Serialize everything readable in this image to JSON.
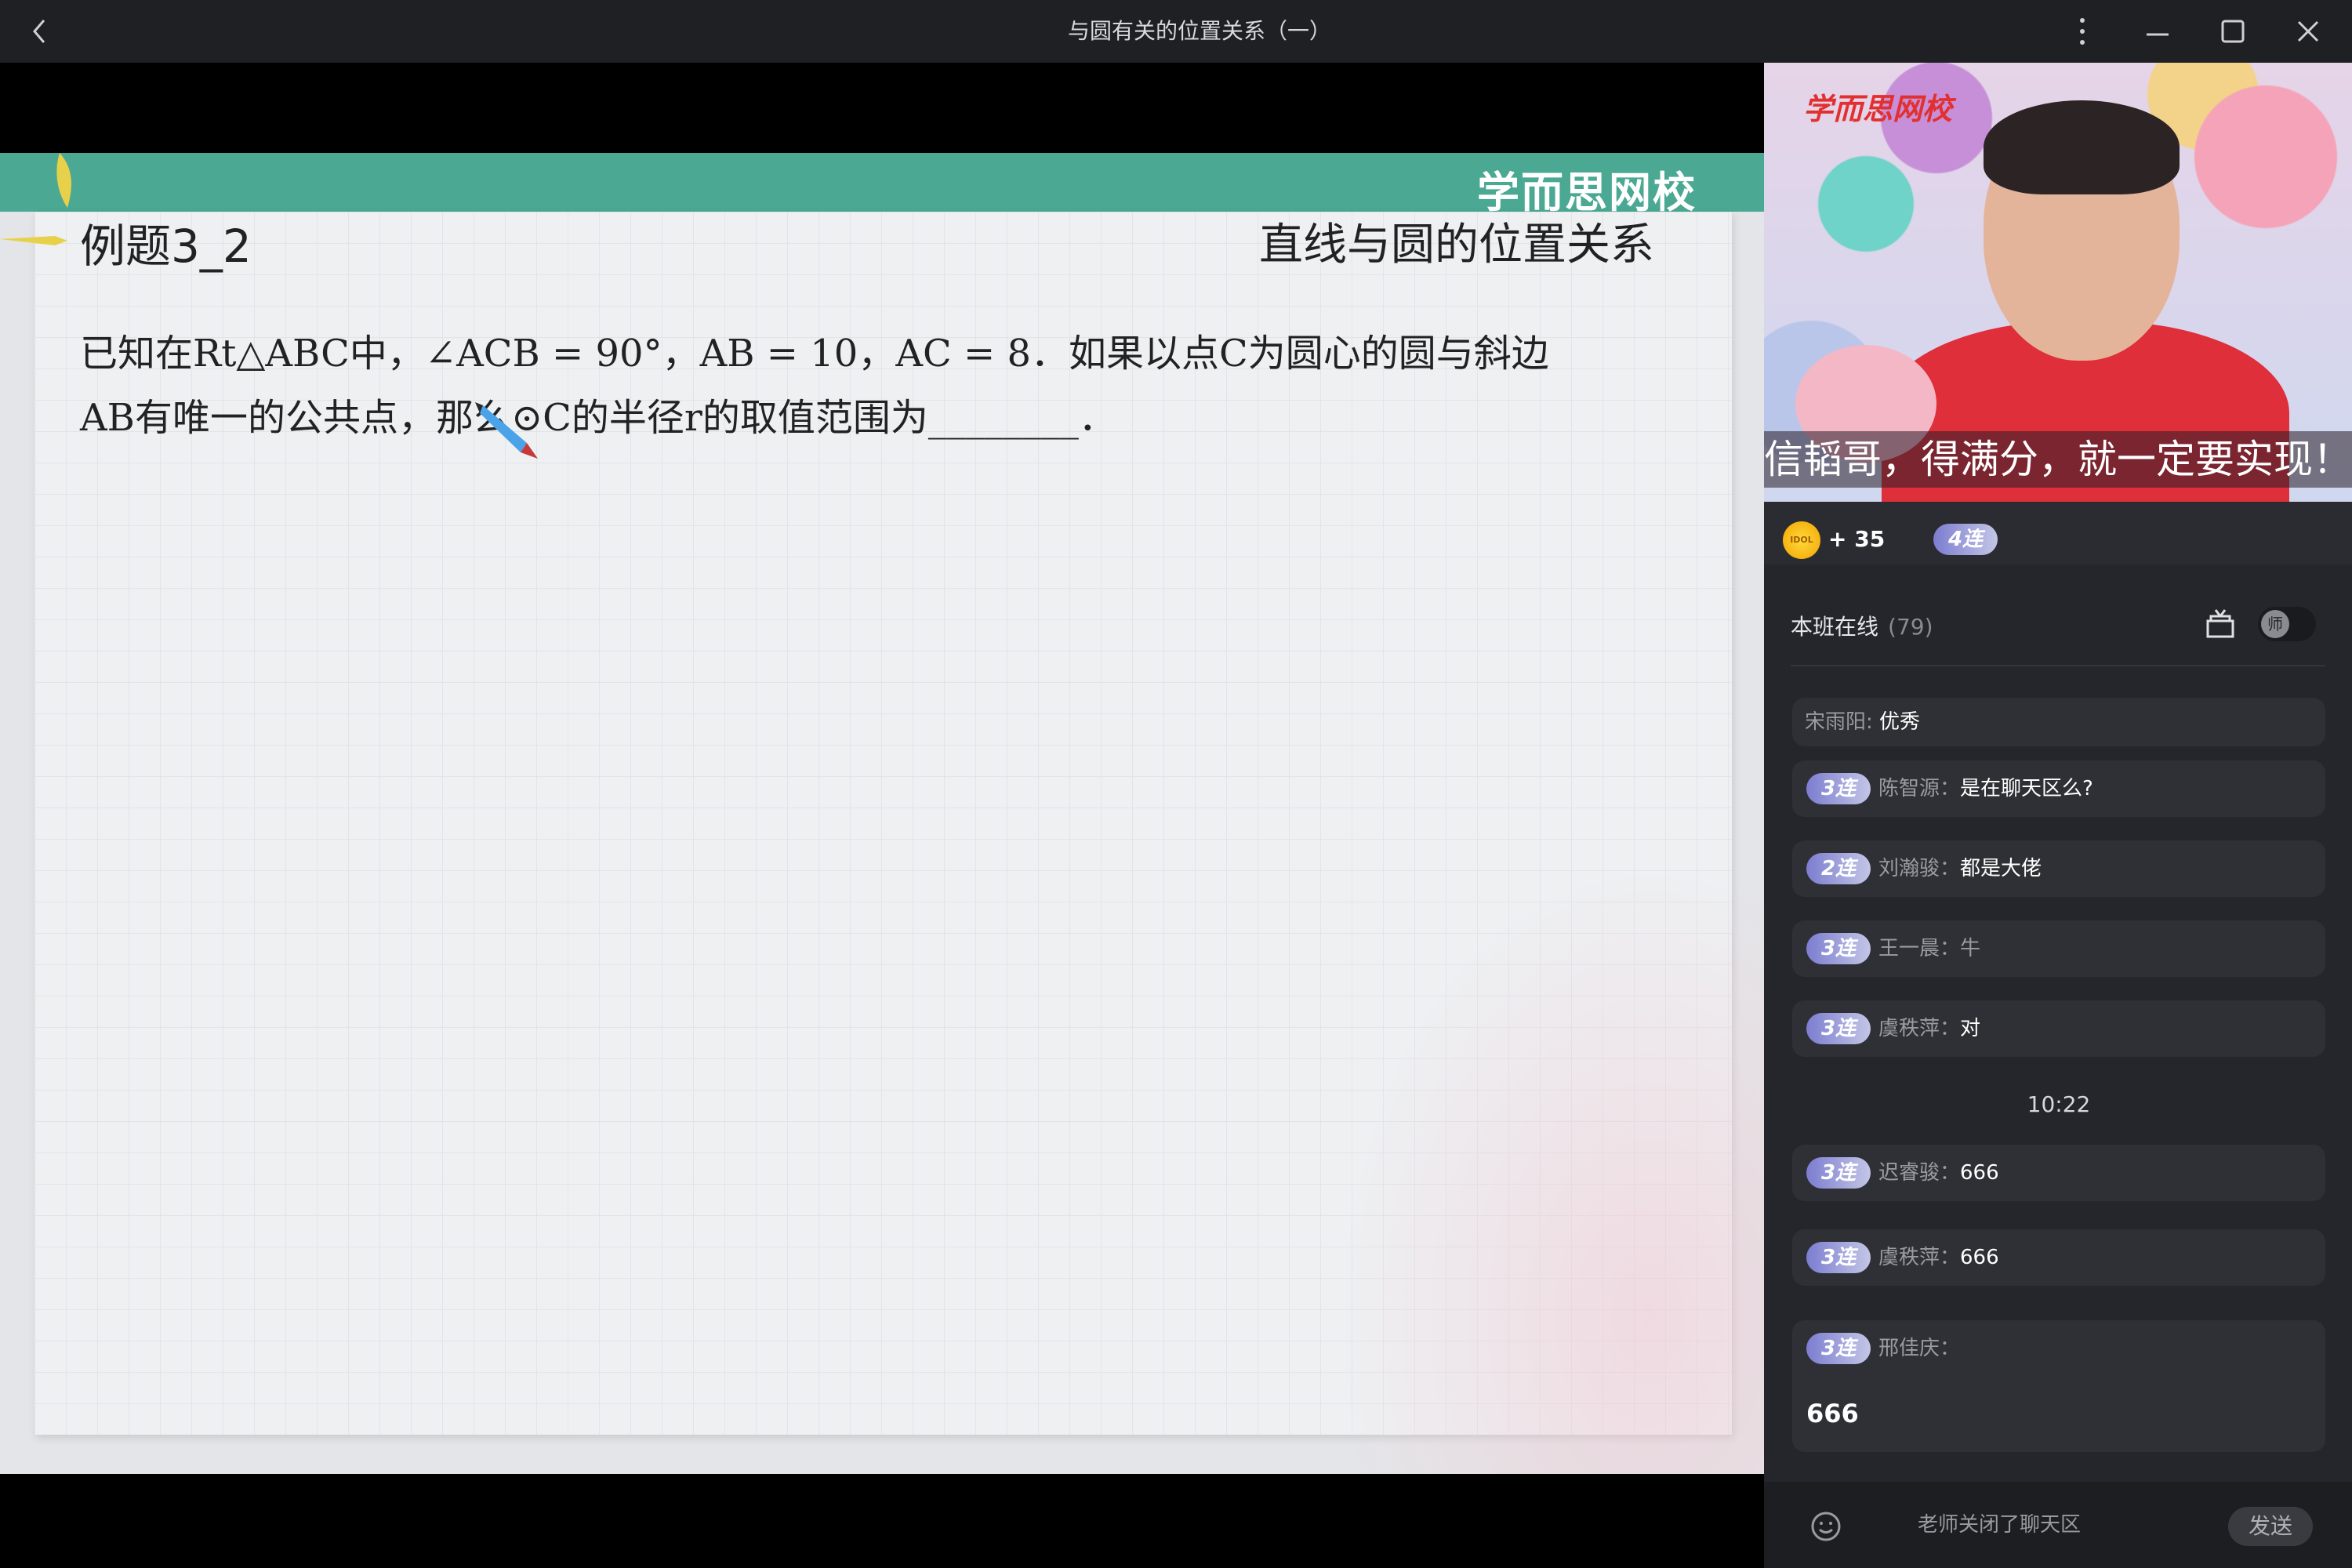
{
  "window": {
    "title": "与圆有关的位置关系（一）"
  },
  "slide": {
    "brand": "学而思网校",
    "example_title": "例题3_2",
    "topic": "直线与圆的位置关系",
    "problem_line1": "已知在Rt△ABC中，∠ACB = 90°，AB = 10，AC = 8．如果以点C为圆心的圆与斜边",
    "problem_line2": "AB有唯一的公共点，那么⊙C的半径r的取值范围为________．"
  },
  "video": {
    "logo": "学而思网校",
    "slogan": "信韬哥，得满分，就一定要实现！"
  },
  "rewards": {
    "coin_label": "IDOL",
    "coin_count": "+ 35",
    "streak": "4连"
  },
  "online": {
    "label": "本班在线",
    "count": "(79)",
    "teacher_toggle": "师"
  },
  "chat": {
    "messages": [
      {
        "streak": "",
        "name": "宋雨阳:",
        "text": "优秀"
      },
      {
        "streak": "3连",
        "name": "陈智源：",
        "text": "是在聊天区么?"
      },
      {
        "streak": "2连",
        "name": "刘瀚骏：",
        "text": "都是大佬"
      },
      {
        "streak": "3连",
        "name": "王一晨：",
        "text": "牛"
      },
      {
        "streak": "3连",
        "name": "虞秩萍：",
        "text": "对"
      },
      {
        "streak": "3连",
        "name": "迟睿骏：",
        "text": "666"
      },
      {
        "streak": "3连",
        "name": "虞秩萍：",
        "text": "666"
      },
      {
        "streak": "3连",
        "name": "邢佳庆：",
        "text": "666"
      }
    ],
    "time": "10:22"
  },
  "input": {
    "placeholder": "老师关闭了聊天区",
    "send": "发送"
  },
  "colors": {
    "slide_band": "#4aa893",
    "panel_bg": "#25262b",
    "titlebar_bg": "#1f2024"
  }
}
